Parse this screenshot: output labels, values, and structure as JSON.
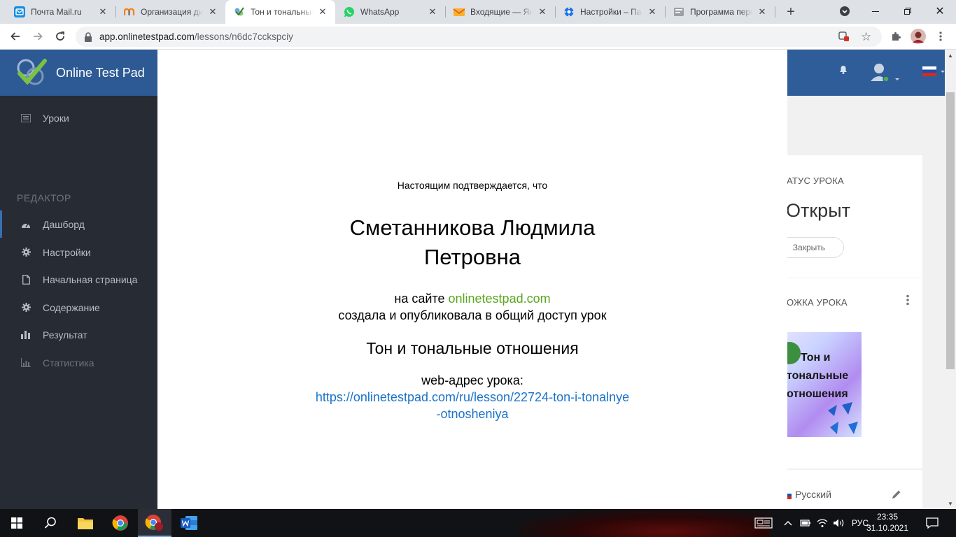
{
  "browser": {
    "tabs": [
      {
        "title": "Почта Mail.ru",
        "icon": "mail-icon"
      },
      {
        "title": "Организация дистанционного",
        "icon": "moodle-icon"
      },
      {
        "title": "Тон и тональные отношения",
        "icon": "onlinetestpad-icon"
      },
      {
        "title": "WhatsApp",
        "icon": "whatsapp-icon"
      },
      {
        "title": "Входящие — Яндекс.Почта",
        "icon": "yandex-mail-icon"
      },
      {
        "title": "Настройки – Пароли",
        "icon": "gear-icon"
      },
      {
        "title": "Программа перевода",
        "icon": "document-icon"
      }
    ],
    "url_host": "app.onlinetestpad.com",
    "url_path": "/lessons/n6dc7cckspciy"
  },
  "app": {
    "brand": "Online Test Pad",
    "sidebar": {
      "top_item": "Уроки",
      "section_header": "РЕДАКТОР",
      "items": [
        "Дашборд",
        "Настройки",
        "Начальная страница",
        "Содержание",
        "Результат",
        "Статистика"
      ]
    },
    "cards": {
      "status_title": "АТУС УРОКА",
      "status_value": "Открыт",
      "close_label": "Закрыть",
      "cover_title": "ОЖКА УРОКА",
      "cover_line1": "Тон и",
      "cover_line2": "тональные",
      "cover_line3": "отношения",
      "language": "Русский"
    }
  },
  "certificate": {
    "intro": "Настоящим подтверждается, что",
    "name": "Сметанникова Людмила Петровна",
    "site_prefix": "на сайте",
    "site_link": "onlinetestpad.com",
    "action": "создала и опубликовала в общий доступ урок",
    "lesson_title": "Тон и тональные отношения",
    "web_label": "web-адрес урока:",
    "lesson_url": "https://onlinetestpad.com/ru/lesson/22724-ton-i-tonalnye-otnosheniya"
  },
  "taskbar": {
    "lang": "РУС",
    "time": "23:35",
    "date": "31.10.2021"
  },
  "colors": {
    "nav_blue": "#2f5d99",
    "sidebar_dark": "#272b33",
    "site_green": "#5aa61e",
    "link_blue": "#1a73c8"
  }
}
